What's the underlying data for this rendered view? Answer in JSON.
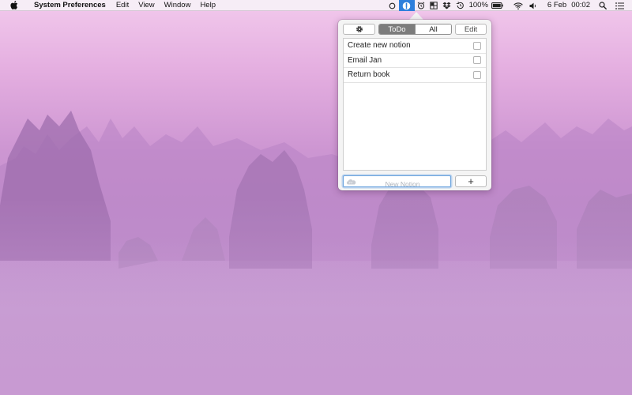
{
  "menubar": {
    "app_name": "System Preferences",
    "menus": [
      "Edit",
      "View",
      "Window",
      "Help"
    ],
    "battery_percent": "100%",
    "date": "6 Feb",
    "time": "00:02"
  },
  "popover": {
    "filter_tabs": [
      "ToDo",
      "All"
    ],
    "selected_filter": "ToDo",
    "edit_label": "Edit",
    "tasks": [
      {
        "title": "Create new notion",
        "done": false
      },
      {
        "title": "Email Jan",
        "done": false
      },
      {
        "title": "Return book",
        "done": false
      }
    ],
    "new_placeholder": "New Notion",
    "add_label": "+"
  },
  "colors": {
    "accent": "#2e7fdc",
    "selected_segment": "#7c7c7c",
    "wallpaper": "#cd96d2"
  }
}
